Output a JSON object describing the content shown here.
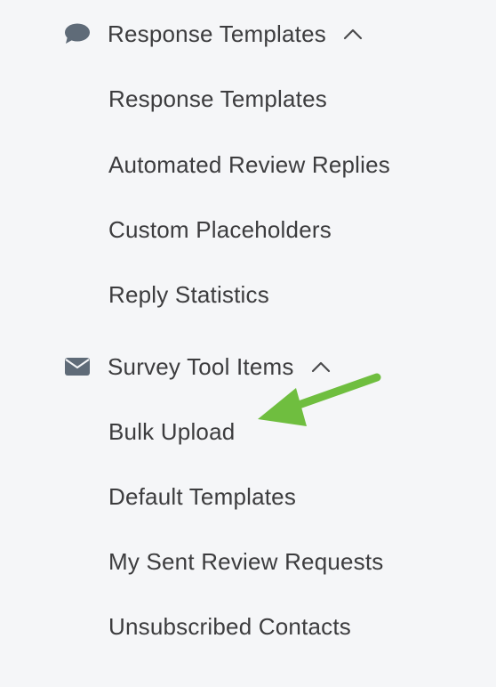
{
  "sidebar": {
    "sections": [
      {
        "label": "Response Templates",
        "icon": "speech-bubble-icon",
        "expanded": true,
        "items": [
          {
            "label": "Response Templates"
          },
          {
            "label": "Automated Review Replies"
          },
          {
            "label": "Custom Placeholders"
          },
          {
            "label": "Reply Statistics"
          }
        ]
      },
      {
        "label": "Survey Tool Items",
        "icon": "envelope-icon",
        "expanded": true,
        "items": [
          {
            "label": "Bulk Upload"
          },
          {
            "label": "Default Templates"
          },
          {
            "label": "My Sent Review Requests"
          },
          {
            "label": "Unsubscribed Contacts"
          }
        ]
      }
    ]
  },
  "annotation": {
    "type": "arrow",
    "color": "#6fbe3f",
    "points_to": "Bulk Upload"
  },
  "colors": {
    "background": "#f5f6f8",
    "text": "#3c3c3e",
    "icon": "#5f6b78"
  }
}
